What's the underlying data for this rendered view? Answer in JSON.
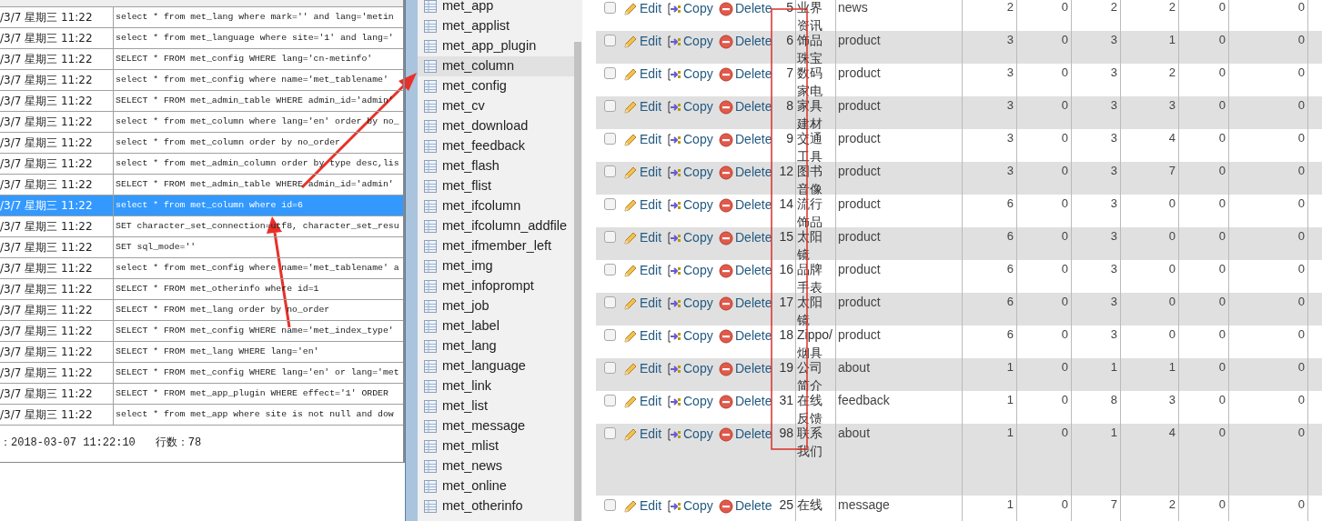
{
  "query_log": {
    "rows": [
      {
        "time": "/3/7 星期三 11:22",
        "query": "select * from met_lang where mark='' and lang='metin",
        "selected": false
      },
      {
        "time": "/3/7 星期三 11:22",
        "query": "select * from met_language where site='1' and lang='",
        "selected": false
      },
      {
        "time": "/3/7 星期三 11:22",
        "query": "SELECT * FROM met_config WHERE lang='cn-metinfo'",
        "selected": false
      },
      {
        "time": "/3/7 星期三 11:22",
        "query": "select * from met_config where name='met_tablename'",
        "selected": false
      },
      {
        "time": "/3/7 星期三 11:22",
        "query": "SELECT * FROM met_admin_table WHERE admin_id='admin'",
        "selected": false
      },
      {
        "time": "/3/7 星期三 11:22",
        "query": "select * from met_column where lang='en' order by no_",
        "selected": false
      },
      {
        "time": "/3/7 星期三 11:22",
        "query": "select * from met_column order by no_order",
        "selected": false
      },
      {
        "time": "/3/7 星期三 11:22",
        "query": "select * from met_admin_column order by type desc,lis",
        "selected": false
      },
      {
        "time": "/3/7 星期三 11:22",
        "query": "SELECT * FROM met_admin_table WHERE admin_id='admin'",
        "selected": false
      },
      {
        "time": "/3/7 星期三 11:22",
        "query": "select * from met_column where id=6",
        "selected": true
      },
      {
        "time": "/3/7 星期三 11:22",
        "query": "SET character_set_connection=utf8, character_set_resu",
        "selected": false
      },
      {
        "time": "/3/7 星期三 11:22",
        "query": "SET sql_mode=''",
        "selected": false
      },
      {
        "time": "/3/7 星期三 11:22",
        "query": "select * from met_config where name='met_tablename' a",
        "selected": false
      },
      {
        "time": "/3/7 星期三 11:22",
        "query": "SELECT * FROM met_otherinfo where id=1",
        "selected": false
      },
      {
        "time": "/3/7 星期三 11:22",
        "query": "SELECT * FROM met_lang order by no_order",
        "selected": false
      },
      {
        "time": "/3/7 星期三 11:22",
        "query": "SELECT * FROM met_config WHERE name='met_index_type'",
        "selected": false
      },
      {
        "time": "/3/7 星期三 11:22",
        "query": "SELECT * FROM met_lang WHERE lang='en'",
        "selected": false
      },
      {
        "time": "/3/7 星期三 11:22",
        "query": "SELECT * FROM met_config WHERE lang='en' or lang='met",
        "selected": false
      },
      {
        "time": "/3/7 星期三 11:22",
        "query": "SELECT * FROM met_app_plugin  WHERE effect='1' ORDER",
        "selected": false
      },
      {
        "time": "/3/7 星期三 11:22",
        "query": "select * from met_app where site is not null and dow",
        "selected": false
      }
    ],
    "status": {
      "time": "：2018-03-07 11:22:10",
      "row_count": "行数：78"
    }
  },
  "table_list": {
    "items": [
      {
        "name": "met_app",
        "selected": false
      },
      {
        "name": "met_applist",
        "selected": false
      },
      {
        "name": "met_app_plugin",
        "selected": false
      },
      {
        "name": "met_column",
        "selected": true
      },
      {
        "name": "met_config",
        "selected": false
      },
      {
        "name": "met_cv",
        "selected": false
      },
      {
        "name": "met_download",
        "selected": false
      },
      {
        "name": "met_feedback",
        "selected": false
      },
      {
        "name": "met_flash",
        "selected": false
      },
      {
        "name": "met_flist",
        "selected": false
      },
      {
        "name": "met_ifcolumn",
        "selected": false
      },
      {
        "name": "met_ifcolumn_addfile",
        "selected": false
      },
      {
        "name": "met_ifmember_left",
        "selected": false
      },
      {
        "name": "met_img",
        "selected": false
      },
      {
        "name": "met_infoprompt",
        "selected": false
      },
      {
        "name": "met_job",
        "selected": false
      },
      {
        "name": "met_label",
        "selected": false
      },
      {
        "name": "met_lang",
        "selected": false
      },
      {
        "name": "met_language",
        "selected": false
      },
      {
        "name": "met_link",
        "selected": false
      },
      {
        "name": "met_list",
        "selected": false
      },
      {
        "name": "met_message",
        "selected": false
      },
      {
        "name": "met_mlist",
        "selected": false
      },
      {
        "name": "met_news",
        "selected": false
      },
      {
        "name": "met_online",
        "selected": false
      },
      {
        "name": "met_otherinfo",
        "selected": false
      }
    ]
  },
  "rows_view": {
    "rows": [
      {
        "checked": false,
        "actions": [
          "Edit",
          "Copy",
          "Delete"
        ],
        "id": "5",
        "name": "业界资讯",
        "type": "news",
        "values": [
          "2",
          "0",
          "2",
          "2",
          "0",
          "0"
        ]
      },
      {
        "checked": false,
        "actions": [
          "Edit",
          "Copy",
          "Delete"
        ],
        "id": "6",
        "name": "饰品珠宝",
        "type": "product",
        "values": [
          "3",
          "0",
          "3",
          "1",
          "0",
          "0"
        ]
      },
      {
        "checked": false,
        "actions": [
          "Edit",
          "Copy",
          "Delete"
        ],
        "id": "7",
        "name": "数码家电",
        "type": "product",
        "values": [
          "3",
          "0",
          "3",
          "2",
          "0",
          "0"
        ]
      },
      {
        "checked": false,
        "actions": [
          "Edit",
          "Copy",
          "Delete"
        ],
        "id": "8",
        "name": "家具建材",
        "type": "product",
        "values": [
          "3",
          "0",
          "3",
          "3",
          "0",
          "0"
        ]
      },
      {
        "checked": false,
        "actions": [
          "Edit",
          "Copy",
          "Delete"
        ],
        "id": "9",
        "name": "交通工具",
        "type": "product",
        "values": [
          "3",
          "0",
          "3",
          "4",
          "0",
          "0"
        ]
      },
      {
        "checked": false,
        "actions": [
          "Edit",
          "Copy",
          "Delete"
        ],
        "id": "12",
        "name": "图书音像",
        "type": "product",
        "values": [
          "3",
          "0",
          "3",
          "7",
          "0",
          "0"
        ]
      },
      {
        "checked": false,
        "actions": [
          "Edit",
          "Copy",
          "Delete"
        ],
        "id": "14",
        "name": "流行饰品",
        "type": "product",
        "values": [
          "6",
          "0",
          "3",
          "0",
          "0",
          "0"
        ]
      },
      {
        "checked": false,
        "actions": [
          "Edit",
          "Copy",
          "Delete"
        ],
        "id": "15",
        "name": "太阳镜",
        "type": "product",
        "values": [
          "6",
          "0",
          "3",
          "0",
          "0",
          "0"
        ]
      },
      {
        "checked": false,
        "actions": [
          "Edit",
          "Copy",
          "Delete"
        ],
        "id": "16",
        "name": "品牌手表",
        "type": "product",
        "values": [
          "6",
          "0",
          "3",
          "0",
          "0",
          "0"
        ]
      },
      {
        "checked": false,
        "actions": [
          "Edit",
          "Copy",
          "Delete"
        ],
        "id": "17",
        "name": "太阳镜",
        "type": "product",
        "values": [
          "6",
          "0",
          "3",
          "0",
          "0",
          "0"
        ]
      },
      {
        "checked": false,
        "actions": [
          "Edit",
          "Copy",
          "Delete"
        ],
        "id": "18",
        "name": "Zippo/烟具",
        "type": "product",
        "values": [
          "6",
          "0",
          "3",
          "0",
          "0",
          "0"
        ]
      },
      {
        "checked": false,
        "actions": [
          "Edit",
          "Copy",
          "Delete"
        ],
        "id": "19",
        "name": "公司简介",
        "type": "about",
        "values": [
          "1",
          "0",
          "1",
          "1",
          "0",
          "0"
        ]
      },
      {
        "checked": false,
        "actions": [
          "Edit",
          "Copy",
          "Delete"
        ],
        "id": "31",
        "name": "在线反馈",
        "type": "feedback",
        "values": [
          "1",
          "0",
          "8",
          "3",
          "0",
          "0"
        ]
      },
      {
        "checked": false,
        "actions": [
          "Edit",
          "Copy",
          "Delete"
        ],
        "id": "98",
        "name": "联系我们",
        "type": "about",
        "values": [
          "1",
          "0",
          "1",
          "4",
          "0",
          "0"
        ]
      },
      {
        "checked": false,
        "actions": [
          "Edit",
          "Copy",
          "Delete"
        ],
        "id": "25",
        "name": "在线",
        "type": "message",
        "values": [
          "1",
          "0",
          "7",
          "2",
          "0",
          "0"
        ]
      }
    ]
  }
}
